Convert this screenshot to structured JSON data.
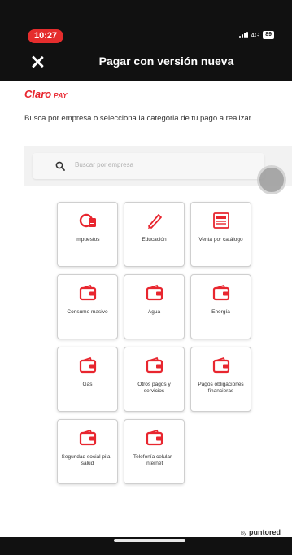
{
  "status_bar": {
    "time": "10:27",
    "network": "4G",
    "battery": "89"
  },
  "header": {
    "title": "Pagar con versión nueva"
  },
  "brand": {
    "logo_main": "Claro",
    "logo_sub": "PAY"
  },
  "instruction": "Busca por empresa o selecciona la categoria de tu pago a realizar",
  "search": {
    "placeholder": "Buscar por empresa"
  },
  "categories": [
    {
      "label": "Impuestos",
      "icon": "tax-icon"
    },
    {
      "label": "Educación",
      "icon": "pencil-icon"
    },
    {
      "label": "Venta por catálogo",
      "icon": "catalog-icon"
    },
    {
      "label": "Consumo masivo",
      "icon": "wallet-icon"
    },
    {
      "label": "Agua",
      "icon": "wallet-icon"
    },
    {
      "label": "Energía",
      "icon": "wallet-icon"
    },
    {
      "label": "Gas",
      "icon": "wallet-icon"
    },
    {
      "label": "Otros pagos y servicios",
      "icon": "wallet-icon"
    },
    {
      "label": "Pagos obligaciones financieras",
      "icon": "wallet-icon"
    },
    {
      "label": "Seguridad social pila - salud",
      "icon": "wallet-icon"
    },
    {
      "label": "Telefonía celular - internet",
      "icon": "wallet-icon"
    }
  ],
  "footer": {
    "by": "By",
    "brand": "puntored"
  },
  "colors": {
    "accent": "#e8262f",
    "header_bg": "#111111"
  }
}
